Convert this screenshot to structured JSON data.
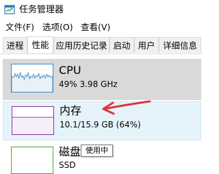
{
  "window": {
    "title": "任务管理器"
  },
  "menu": [
    {
      "label": "文件(F)"
    },
    {
      "label": "选项(O)"
    },
    {
      "label": "查看(V)"
    }
  ],
  "tabs": [
    {
      "label": "进程",
      "active": false
    },
    {
      "label": "性能",
      "active": true
    },
    {
      "label": "应用历史记录",
      "active": false
    },
    {
      "label": "启动",
      "active": false
    },
    {
      "label": "用户",
      "active": false
    },
    {
      "label": "详细信息",
      "active": false
    }
  ],
  "resources": [
    {
      "name": "CPU",
      "detail": "49%  3.98 GHz",
      "color": "#3e88c2",
      "state": "selected"
    },
    {
      "name": "内存",
      "detail": "10.1/15.9 GB (64%)",
      "color": "#8b2ca0",
      "state": "hover",
      "usage_percent": 64
    },
    {
      "name": "磁盘",
      "detail": "SSD",
      "color": "#4da833",
      "state": "normal"
    }
  ],
  "tooltip": {
    "text": "使用中"
  },
  "colors": {
    "annotation_arrow": "#e0333a",
    "selected_bg": "#d9d9d9",
    "hover_bg": "#e5f3fb"
  }
}
